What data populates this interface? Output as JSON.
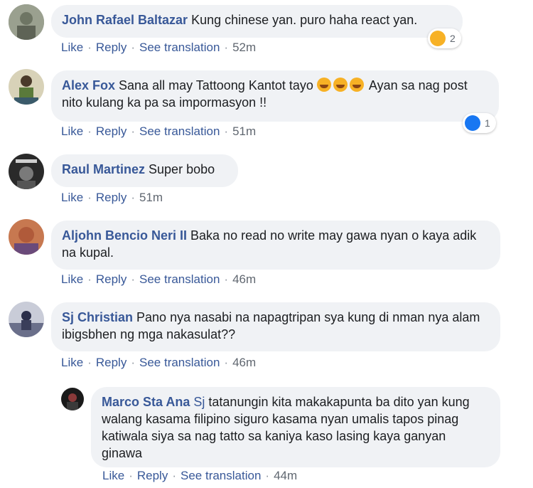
{
  "comments": [
    {
      "name": "John Rafael Baltazar",
      "text": "Kung chinese yan. puro haha react yan.",
      "actions": [
        "Like",
        "Reply",
        "See translation"
      ],
      "time": "52m",
      "reaction_count": "2"
    },
    {
      "name": "Alex Fox",
      "text_a": "Sana all may Tattoong Kantot tayo",
      "text_b": "Ayan sa nag post nito kulang ka pa sa impormasyon !!",
      "actions": [
        "Like",
        "Reply",
        "See translation"
      ],
      "time": "51m",
      "reaction_count": "1"
    },
    {
      "name": "Raul Martinez",
      "text": "Super bobo",
      "actions": [
        "Like",
        "Reply"
      ],
      "time": "51m"
    },
    {
      "name": "Aljohn Bencio Neri II",
      "text": "Baka no read no write may gawa nyan o kaya adik na kupal.",
      "actions": [
        "Like",
        "Reply",
        "See translation"
      ],
      "time": "46m"
    },
    {
      "name": "Sj Christian",
      "text": "Pano nya nasabi na napagtripan sya kung di nman nya alam ibigsbhen ng mga nakasulat??",
      "actions": [
        "Like",
        "Reply",
        "See translation"
      ],
      "time": "46m"
    },
    {
      "name": "Marco Sta Ana",
      "mention": "Sj",
      "text": "tatanungin kita makakapunta ba dito yan kung walang kasama filipino siguro kasama nyan umalis tapos pinag katiwala siya sa nag tatto sa kaniya kaso lasing kaya ganyan ginawa",
      "actions": [
        "Like",
        "Reply",
        "See translation"
      ],
      "time": "44m"
    }
  ],
  "colors": {
    "link": "#385898",
    "bubble": "#f0f2f5",
    "meta": "#606770"
  },
  "icons": {
    "haha_reaction": "haha-icon",
    "like_reaction": "like-icon",
    "laughing_emoji": "rolling-laughing-emoji"
  }
}
